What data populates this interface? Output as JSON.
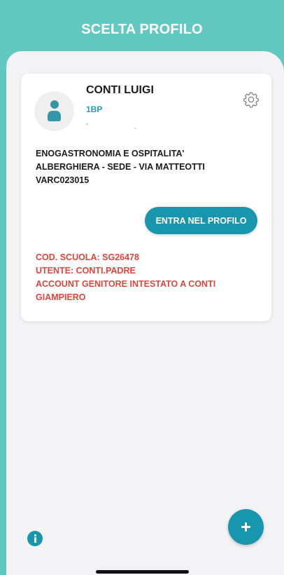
{
  "header": {
    "title": "SCELTA PROFILO"
  },
  "profile_card": {
    "name": "CONTI LUIGI",
    "class_code": "1BP",
    "school_lines": [
      "ENOGASTRONOMIA E OSPITALITA'",
      "ALBERGHIERA - SEDE -  VIA MATTEOTTI",
      "VARC023015"
    ],
    "enter_button_label": "ENTRA NEL PROFILO",
    "info_lines": [
      "COD. SCUOLA: SG26478",
      "UTENTE: CONTI.PADRE",
      "ACCOUNT GENITORE INTESTATO A CONTI",
      "GIAMPIERO"
    ]
  },
  "icons": {
    "avatar": "person-icon",
    "settings": "gear-icon",
    "add": "plus-icon",
    "info": "info-icon"
  },
  "colors": {
    "header_bg": "#64c8c2",
    "accent": "#1896ad",
    "alert_text": "#e0443b",
    "background": "#f3f3f5"
  }
}
